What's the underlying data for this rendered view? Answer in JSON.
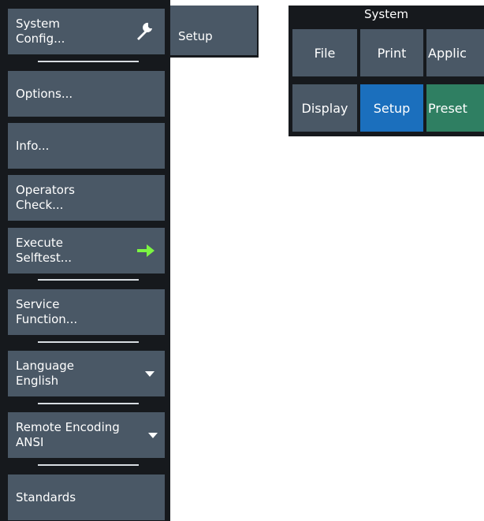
{
  "softkeys": {
    "system_config": {
      "line1": "System",
      "line2": "Config..."
    },
    "options": "Options...",
    "info": "Info...",
    "operators_check": {
      "line1": "Operators",
      "line2": "Check..."
    },
    "execute_selftest": {
      "line1": "Execute",
      "line2": "Selftest..."
    },
    "service_function": {
      "line1": "Service",
      "line2": "Function..."
    },
    "language": {
      "label": "Language",
      "value": "English"
    },
    "remote_encoding": {
      "label": "Remote Encoding",
      "value": "ANSI"
    },
    "standards": "Standards"
  },
  "setup_tab": "Setup",
  "system_group": {
    "title": "System",
    "buttons": [
      "File",
      "Print",
      "Applic",
      "Display",
      "Setup",
      "Preset"
    ]
  },
  "colors": {
    "panel_bg": "#16191d",
    "softkey_bg": "#4a5866",
    "active_blue": "#1b6fbd",
    "preset_green": "#2f7f62",
    "arrow_green": "#7cf542"
  },
  "icons": {
    "system_config": "wrench-icon",
    "execute_selftest": "right-arrow-icon",
    "language": "dropdown-triangle-icon",
    "remote_encoding": "dropdown-triangle-icon"
  }
}
